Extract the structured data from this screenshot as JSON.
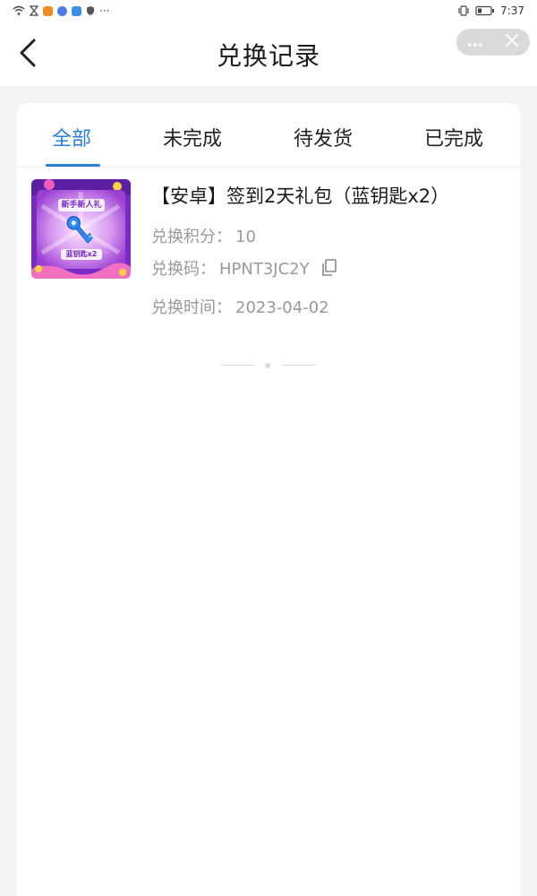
{
  "status_bar": {
    "time": "7:37",
    "left_icons": [
      "wifi-icon",
      "hourglass-icon",
      "app-orange-icon",
      "app-blue-icon",
      "app-cloud-icon",
      "shield-icon",
      "more-dots-icon"
    ],
    "right_icons": [
      "vibrate-icon",
      "battery-icon"
    ]
  },
  "header": {
    "title": "兑换记录",
    "back_icon": "chevron-left-icon",
    "capsule": {
      "more_icon": "more-dots-icon",
      "close_icon": "close-icon"
    }
  },
  "tabs": [
    {
      "label": "全部",
      "active": true
    },
    {
      "label": "未完成",
      "active": false
    },
    {
      "label": "待发货",
      "active": false
    },
    {
      "label": "已完成",
      "active": false
    }
  ],
  "records": [
    {
      "title": "【安卓】签到2天礼包（蓝钥匙x2）",
      "points_label": "兑换积分：",
      "points_value": "10",
      "code_label": "兑换码：",
      "code_value": "HPNT3JC2Y",
      "time_label": "兑换时间：",
      "time_value": "2023-04-02",
      "thumbnail": {
        "banner_text": "新手新人礼",
        "bottom_text": "蓝钥匙x2",
        "icon": "blue-key-icon"
      }
    }
  ],
  "colors": {
    "accent": "#2a7fd6",
    "page_bg": "#f2f3f5",
    "muted_text": "#999999"
  }
}
